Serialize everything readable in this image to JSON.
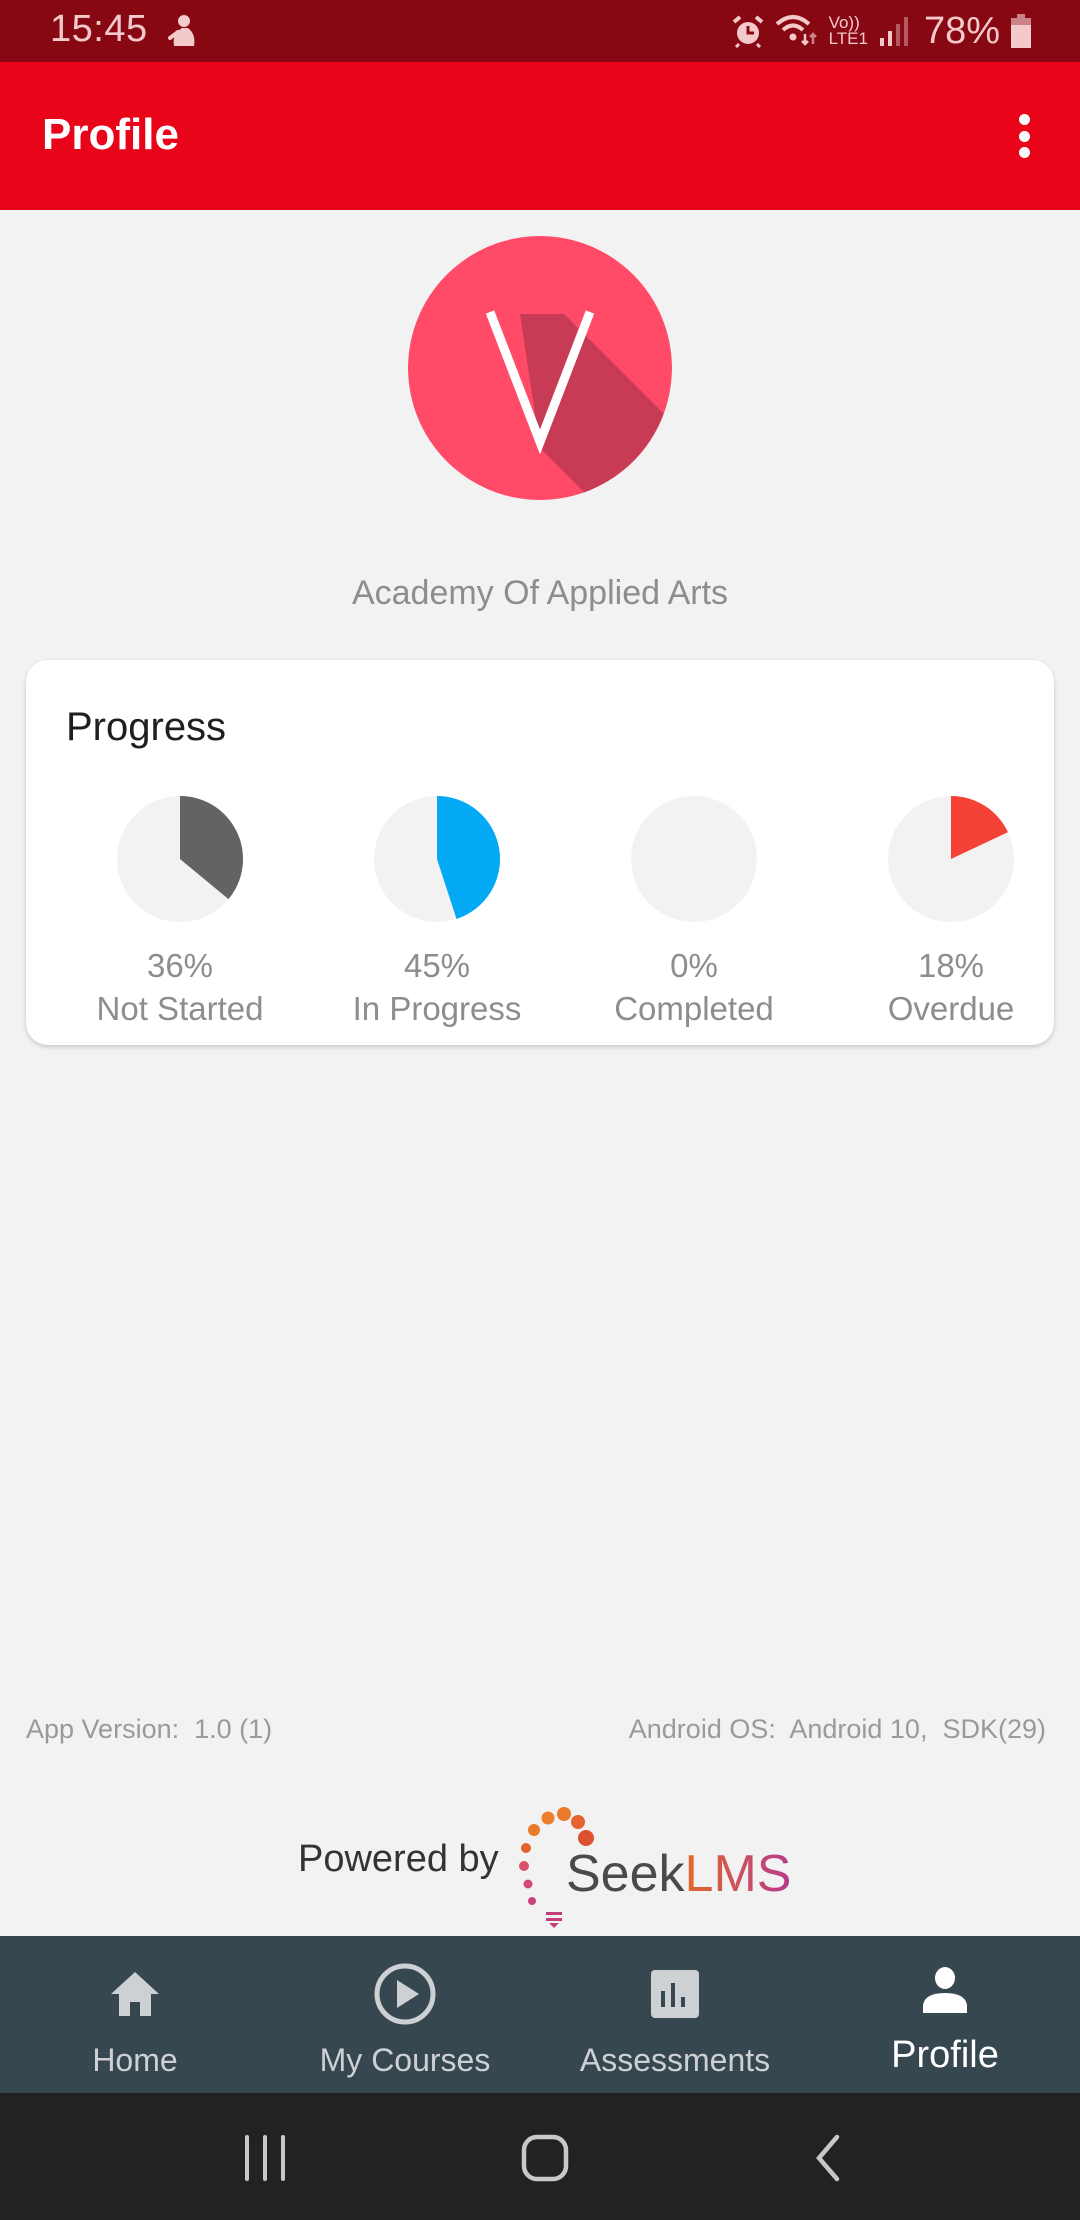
{
  "status_bar": {
    "time": "15:45",
    "battery": "78%",
    "icons": [
      "notification-icon",
      "alarm-icon",
      "wifi-icon",
      "volte-icon",
      "signal-icon",
      "battery-icon"
    ],
    "volte_text": "Vo))",
    "lte_text": "LTE1"
  },
  "app_bar": {
    "title": "Profile",
    "menu_icon": "more-vert-icon"
  },
  "profile": {
    "avatar_letter": "V",
    "avatar_color": "#ff4b67",
    "organization": "Academy Of Applied Arts"
  },
  "progress": {
    "title": "Progress",
    "items": [
      {
        "percent_label": "36%",
        "label": "Not Started",
        "value": 36,
        "color": "#636363"
      },
      {
        "percent_label": "45%",
        "label": "In Progress",
        "value": 45,
        "color": "#03a9f4"
      },
      {
        "percent_label": "0%",
        "label": "Completed",
        "value": 0,
        "color": "#4caf50"
      },
      {
        "percent_label": "18%",
        "label": "Overdue",
        "value": 18,
        "color": "#f44336"
      }
    ]
  },
  "footer": {
    "app_version": "App Version:  1.0 (1)",
    "os_version": "Android OS:  Android 10,  SDK(29)",
    "powered_by": "Powered by",
    "brand_seek": "Seek",
    "brand_lms": "LMS"
  },
  "bottom_nav": {
    "items": [
      {
        "label": "Home",
        "icon": "home-icon",
        "active": false
      },
      {
        "label": "My Courses",
        "icon": "play-circle-icon",
        "active": false
      },
      {
        "label": "Assessments",
        "icon": "assessment-icon",
        "active": false
      },
      {
        "label": "Profile",
        "icon": "person-icon",
        "active": true
      }
    ]
  },
  "system_nav": {
    "buttons": [
      "recents-button",
      "home-button",
      "back-button"
    ]
  },
  "colors": {
    "status_bar": "#870812",
    "app_bar": "#e8051a",
    "bottom_nav": "#37474f",
    "background": "#f2f2f2"
  }
}
